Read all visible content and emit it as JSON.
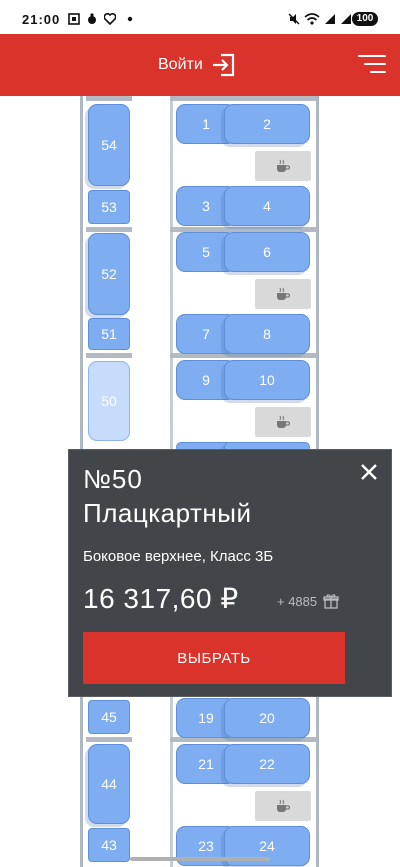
{
  "status_bar": {
    "time": "21:00",
    "battery": "100"
  },
  "header": {
    "login_label": "Войти",
    "brand_color": "#d9332b"
  },
  "seats": {
    "s1": "1",
    "s2": "2",
    "s3": "3",
    "s4": "4",
    "s5": "5",
    "s6": "6",
    "s7": "7",
    "s8": "8",
    "s9": "9",
    "s10": "10",
    "s19": "19",
    "s20": "20",
    "s21": "21",
    "s22": "22",
    "s23": "23",
    "s24": "24",
    "s43": "43",
    "s44": "44",
    "s45": "45",
    "s50": "50",
    "s51": "51",
    "s52": "52",
    "s53": "53",
    "s54": "54"
  },
  "popup": {
    "seat_number": "№50",
    "car_type": "Плацкартный",
    "description": "Боковое верхнее, Класс 3Б",
    "price": "16 317,60 ₽",
    "bonus": "+ 4885",
    "select_label": "ВЫБРАТЬ",
    "close_icon": "close-icon",
    "gift_icon": "gift-icon"
  },
  "colors": {
    "seat_available": "#7fadf2",
    "seat_selected": "#c6dcfa",
    "popup_background": "#424549",
    "action_button": "#d9332b"
  }
}
